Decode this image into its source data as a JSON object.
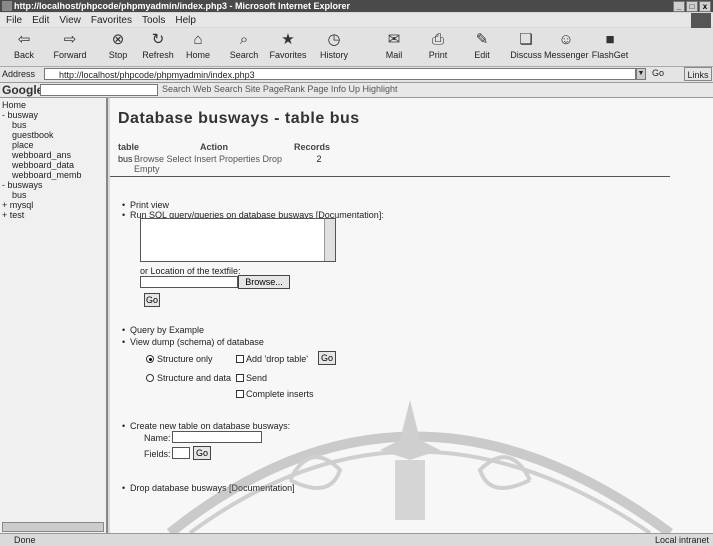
{
  "window": {
    "title": "http://localhost/phpcode/phpmyadmin/index.php3 - Microsoft Internet Explorer",
    "controls": [
      "_",
      "□",
      "x"
    ]
  },
  "menu": [
    "File",
    "Edit",
    "View",
    "Favorites",
    "Tools",
    "Help"
  ],
  "toolbar": {
    "buttons": [
      {
        "label": "Back",
        "icon": "back-arrow-icon"
      },
      {
        "label": "Forward",
        "icon": "forward-arrow-icon"
      },
      {
        "label": "Stop",
        "icon": "stop-icon"
      },
      {
        "label": "Refresh",
        "icon": "refresh-icon"
      },
      {
        "label": "Home",
        "icon": "home-icon"
      },
      {
        "label": "Search",
        "icon": "search-icon"
      },
      {
        "label": "Favorites",
        "icon": "favorites-icon"
      },
      {
        "label": "History",
        "icon": "history-icon"
      },
      {
        "label": "Mail",
        "icon": "mail-icon"
      },
      {
        "label": "Print",
        "icon": "print-icon"
      },
      {
        "label": "Edit",
        "icon": "edit-icon"
      },
      {
        "label": "Discuss",
        "icon": "discuss-icon"
      },
      {
        "label": "Messenger",
        "icon": "messenger-icon"
      },
      {
        "label": "FlashGet",
        "icon": "flashget-icon"
      }
    ]
  },
  "address": {
    "label": "Address",
    "url": "http://localhost/phpcode/phpmyadmin/index.php3",
    "go": "Go",
    "links": "Links"
  },
  "google_bar": {
    "logo": "Google",
    "items": "Search Web   Search Site   PageRank   Page Info   Up   Highlight"
  },
  "nav_tree": [
    "Home",
    "- busway",
    "    bus",
    "    guestbook",
    "    place",
    "    webboard_ans",
    "    webboard_data",
    "    webboard_memb",
    "- busways",
    "    bus",
    "+ mysql",
    "+ test"
  ],
  "main": {
    "title": "Database busways - table bus",
    "table_headers": [
      "table",
      "Action",
      "Records"
    ],
    "table_row": {
      "name": "bus",
      "actions": "Browse Select Insert Properties Drop Empty",
      "records": "2"
    },
    "print_view": "Print view",
    "run_sql": "Run SQL query/queries on database busways [Documentation]:",
    "or_location": "or Location of the textfile:",
    "browse": "Browse...",
    "go": "Go",
    "query_by_example": "Query by Example",
    "view_dump": "View dump (schema) of database",
    "structure_only": "Structure only",
    "add_drop_table": "Add 'drop table'",
    "structure_and_data": "Structure and data",
    "send": "Send",
    "complete_inserts": "Complete inserts",
    "create_new_table": "Create new table on database busways:",
    "name_label": "Name:",
    "fields_label": "Fields:",
    "drop_database": "Drop database busways [Documentation]"
  },
  "status": {
    "text": "Done",
    "zone": "Local intranet"
  }
}
